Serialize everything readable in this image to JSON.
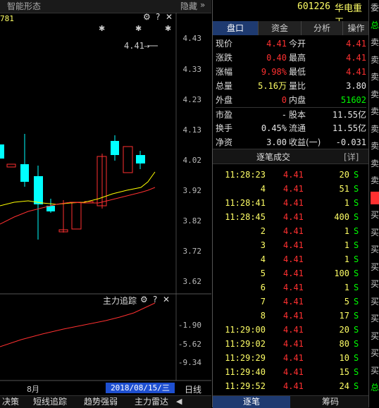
{
  "chart": {
    "tab_label": "智能形态",
    "hide_label": "隐藏",
    "hide_chevron": "»",
    "partial_code": "781",
    "price_marker": "4.41",
    "price_axis": [
      "4.43",
      "4.33",
      "4.23",
      "4.13",
      "4.02",
      "3.92",
      "3.82",
      "3.72",
      "3.62"
    ],
    "indicator_title": "主力追踪",
    "indicator_axis": [
      "-1.90",
      "-5.62",
      "-9.34"
    ],
    "x_month": "8月",
    "date_badge": "2018/08/15/三",
    "period_label": "日线",
    "bottom_tabs": [
      "决策",
      "短线追踪",
      "趋势强弱",
      "主力雷达"
    ]
  },
  "quote": {
    "code": "601226",
    "name": "华电重工",
    "tabs": [
      "盘口",
      "资金",
      "分析",
      "操作"
    ],
    "rows": [
      {
        "l1": "现价",
        "v1": "4.41",
        "c1": "red",
        "l2": "今开",
        "v2": "4.41",
        "c2": "red"
      },
      {
        "l1": "涨跌",
        "v1": "0.40",
        "c1": "red",
        "l2": "最高",
        "v2": "4.41",
        "c2": "red"
      },
      {
        "l1": "涨幅",
        "v1": "9.98%",
        "c1": "red",
        "l2": "最低",
        "v2": "4.41",
        "c2": "red"
      },
      {
        "l1": "总量",
        "v1": "5.16万",
        "c1": "yellow",
        "l2": "量比",
        "v2": "3.80",
        "c2": "white"
      },
      {
        "l1": "外盘",
        "v1": "0",
        "c1": "red",
        "l2": "内盘",
        "v2": "51602",
        "c2": "green"
      },
      {
        "l1": "市盈",
        "v1": "-",
        "c1": "white",
        "l2": "股本",
        "v2": "11.55亿",
        "c2": "white"
      },
      {
        "l1": "换手",
        "v1": "0.45%",
        "c1": "white",
        "l2": "流通",
        "v2": "11.55亿",
        "c2": "white"
      },
      {
        "l1": "净资",
        "v1": "3.00",
        "c1": "white",
        "l2": "收益(一)",
        "v2": "-0.031",
        "c2": "white"
      }
    ],
    "trades_title": "逐笔成交",
    "trades_detail": "[详]",
    "trades": [
      {
        "time": "11:28:23",
        "price": "4.41",
        "vol": "20",
        "side": "S"
      },
      {
        "time": "4",
        "price": "4.41",
        "vol": "51",
        "side": "S"
      },
      {
        "time": "11:28:41",
        "price": "4.41",
        "vol": "1",
        "side": "S"
      },
      {
        "time": "11:28:45",
        "price": "4.41",
        "vol": "400",
        "side": "S"
      },
      {
        "time": "2",
        "price": "4.41",
        "vol": "1",
        "side": "S"
      },
      {
        "time": "3",
        "price": "4.41",
        "vol": "1",
        "side": "S"
      },
      {
        "time": "4",
        "price": "4.41",
        "vol": "1",
        "side": "S"
      },
      {
        "time": "5",
        "price": "4.41",
        "vol": "100",
        "side": "S"
      },
      {
        "time": "6",
        "price": "4.41",
        "vol": "1",
        "side": "S"
      },
      {
        "time": "7",
        "price": "4.41",
        "vol": "5",
        "side": "S"
      },
      {
        "time": "8",
        "price": "4.41",
        "vol": "17",
        "side": "S"
      },
      {
        "time": "11:29:00",
        "price": "4.41",
        "vol": "20",
        "side": "S"
      },
      {
        "time": "11:29:02",
        "price": "4.41",
        "vol": "80",
        "side": "S"
      },
      {
        "time": "11:29:29",
        "price": "4.41",
        "vol": "10",
        "side": "S"
      },
      {
        "time": "11:29:40",
        "price": "4.41",
        "vol": "15",
        "side": "S"
      },
      {
        "time": "11:29:52",
        "price": "4.41",
        "vol": "24",
        "side": "S"
      }
    ],
    "bottom_tabs": [
      "逐笔",
      "筹码"
    ],
    "strip_chars": [
      "委",
      "总",
      "卖",
      "卖",
      "卖",
      "卖",
      "卖",
      "卖",
      "卖",
      "卖",
      "卖",
      "",
      "买",
      "买",
      "买",
      "买",
      "买",
      "买",
      "买",
      "买",
      "买",
      "买",
      "总"
    ]
  },
  "colors": {
    "up": "#ff3030",
    "down": "#00ffff",
    "ma1": "#ffff00",
    "ma2": "#ff3030"
  }
}
